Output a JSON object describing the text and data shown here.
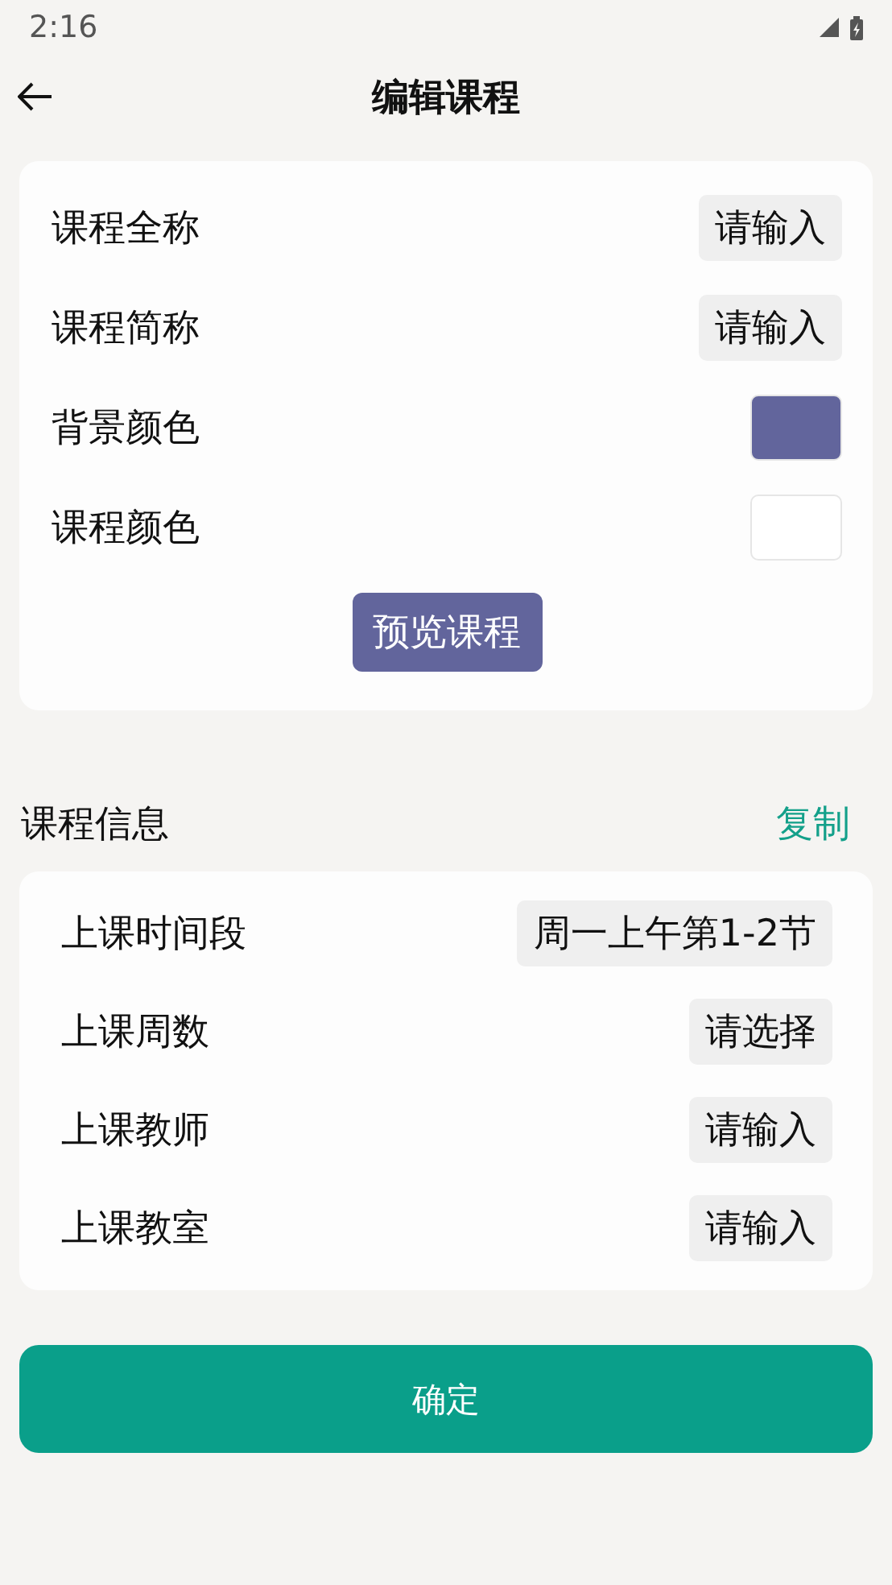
{
  "status_bar": {
    "time": "2:16"
  },
  "header": {
    "title": "编辑课程"
  },
  "basic": {
    "rows": [
      {
        "kind": "input",
        "label": "课程全称",
        "placeholder": "请输入"
      },
      {
        "kind": "input",
        "label": "课程简称",
        "placeholder": "请输入"
      },
      {
        "kind": "color",
        "label": "背景颜色",
        "color": "#62659c"
      },
      {
        "kind": "color",
        "label": "课程颜色",
        "color": "#ffffff"
      }
    ],
    "preview_button": "预览课程"
  },
  "info": {
    "title": "课程信息",
    "action": "复制",
    "rows": [
      {
        "label": "上课时间段",
        "value": "周一上午第1-2节"
      },
      {
        "label": "上课周数",
        "placeholder": "请选择"
      },
      {
        "label": "上课教师",
        "placeholder": "请输入"
      },
      {
        "label": "上课教室",
        "placeholder": "请输入"
      }
    ]
  },
  "confirm_button": "确定"
}
